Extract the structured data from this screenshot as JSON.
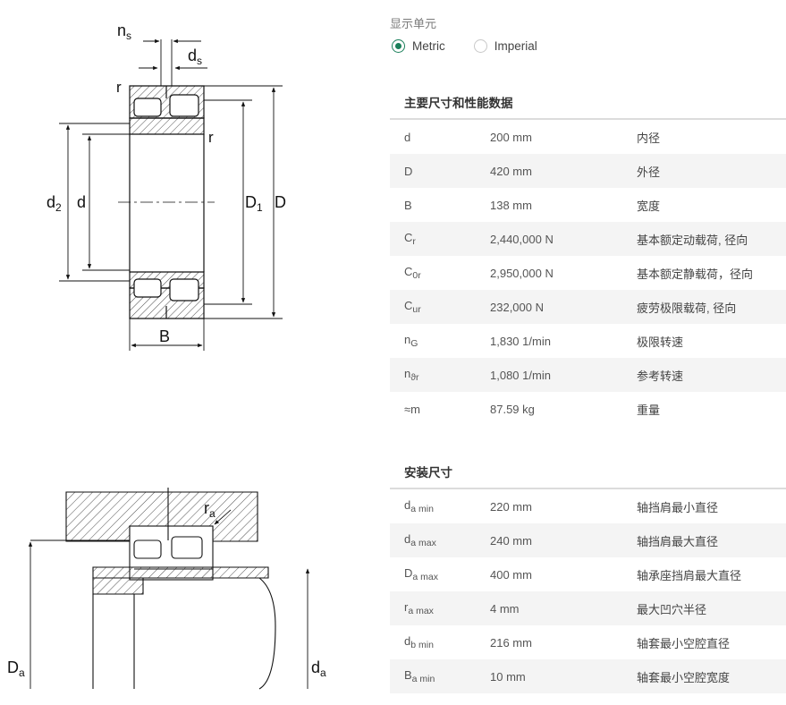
{
  "drawing_labels": {
    "ns": "n",
    "ns_sub": "s",
    "ds": "d",
    "ds_sub": "s",
    "r_top": "r",
    "r_right": "r",
    "d2": "d",
    "d2_sub": "2",
    "d": "d",
    "D1": "D",
    "D1_sub": "1",
    "D": "D",
    "B": "B"
  },
  "mounting_labels": {
    "ra": "r",
    "ra_sub": "a",
    "Da": "D",
    "Da_sub": "a",
    "da": "d",
    "da_sub": "a"
  },
  "units": {
    "label": "显示单元",
    "options": [
      {
        "label": "Metric",
        "selected": true
      },
      {
        "label": "Imperial",
        "selected": false
      }
    ]
  },
  "main_section": {
    "title": "主要尺寸和性能数据",
    "rows": [
      {
        "sym": "d",
        "sub": "",
        "value": "200 mm",
        "desc": "内径"
      },
      {
        "sym": "D",
        "sub": "",
        "value": "420 mm",
        "desc": "外径"
      },
      {
        "sym": "B",
        "sub": "",
        "value": "138 mm",
        "desc": "宽度"
      },
      {
        "sym": "C",
        "sub": "r",
        "value": "2,440,000 N",
        "desc": "基本额定动载荷, 径向"
      },
      {
        "sym": "C",
        "sub": "0r",
        "value": "2,950,000 N",
        "desc": "基本额定静载荷，径向"
      },
      {
        "sym": "C",
        "sub": "ur",
        "value": "232,000 N",
        "desc": "疲劳极限载荷, 径向"
      },
      {
        "sym": "n",
        "sub": "G",
        "value": "1,830 1/min",
        "desc": "极限转速"
      },
      {
        "sym": "n",
        "sub": "ϑr",
        "value": "1,080 1/min",
        "desc": "参考转速"
      },
      {
        "sym": "≈m",
        "sub": "",
        "value": "87.59 kg",
        "desc": "重量"
      }
    ]
  },
  "mounting_section": {
    "title": "安装尺寸",
    "rows": [
      {
        "sym": "d",
        "sub": "a min",
        "value": "220 mm",
        "desc": "轴挡肩最小直径"
      },
      {
        "sym": "d",
        "sub": "a max",
        "value": "240 mm",
        "desc": "轴挡肩最大直径"
      },
      {
        "sym": "D",
        "sub": "a max",
        "value": "400 mm",
        "desc": "轴承座挡肩最大直径"
      },
      {
        "sym": "r",
        "sub": "a max",
        "value": "4 mm",
        "desc": "最大凹穴半径"
      },
      {
        "sym": "d",
        "sub": "b min",
        "value": "216 mm",
        "desc": "轴套最小空腔直径"
      },
      {
        "sym": "B",
        "sub": "a min",
        "value": "10 mm",
        "desc": "轴套最小空腔宽度"
      }
    ]
  }
}
